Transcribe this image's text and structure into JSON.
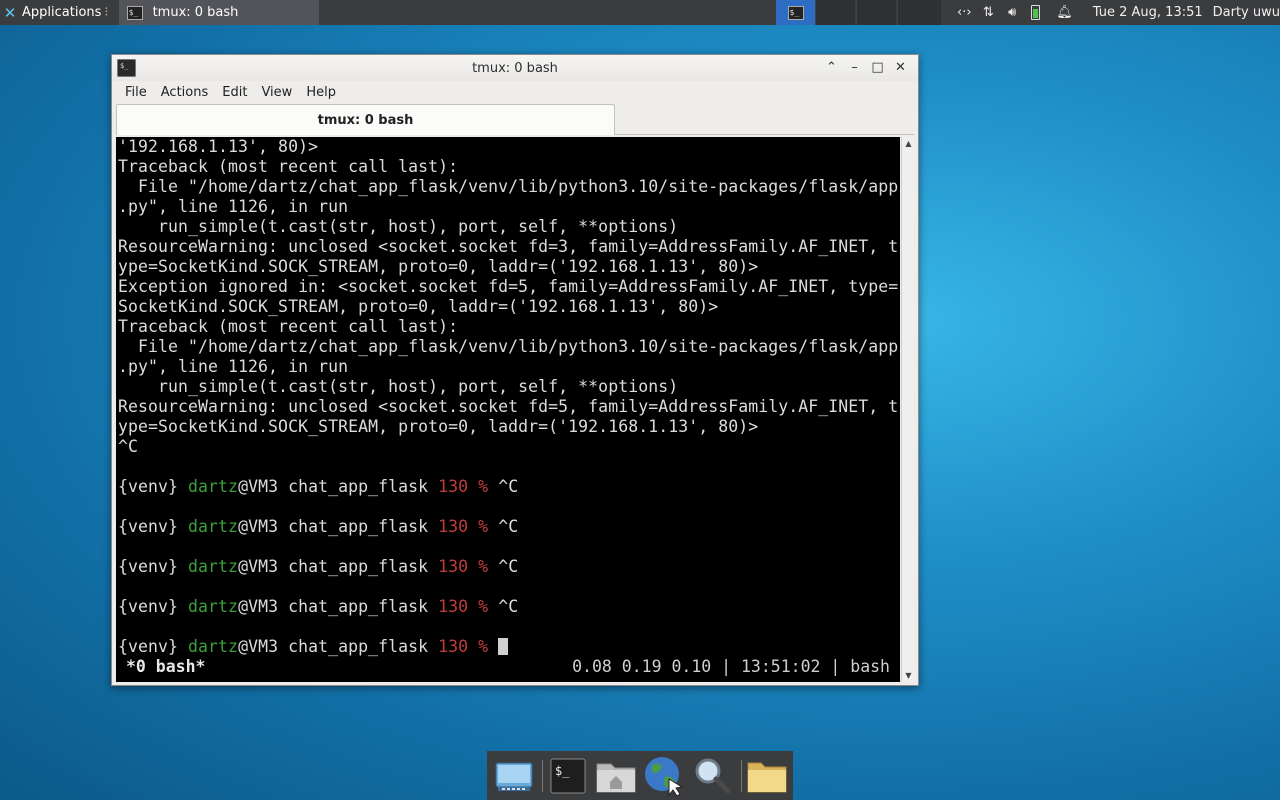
{
  "top_panel": {
    "applications_label": "Applications",
    "task_title": "tmux: 0 bash",
    "clock": "Tue  2 Aug, 13:51",
    "user": "Darty uwu"
  },
  "window": {
    "title": "tmux: 0 bash",
    "menu": [
      "File",
      "Actions",
      "Edit",
      "View",
      "Help"
    ],
    "tab_label": "tmux: 0 bash"
  },
  "terminal": {
    "lines": [
      "'192.168.1.13', 80)>",
      "Traceback (most recent call last):",
      "  File \"/home/dartz/chat_app_flask/venv/lib/python3.10/site-packages/flask/app",
      ".py\", line 1126, in run",
      "    run_simple(t.cast(str, host), port, self, **options)",
      "ResourceWarning: unclosed <socket.socket fd=3, family=AddressFamily.AF_INET, t",
      "ype=SocketKind.SOCK_STREAM, proto=0, laddr=('192.168.1.13', 80)>",
      "Exception ignored in: <socket.socket fd=5, family=AddressFamily.AF_INET, type=",
      "SocketKind.SOCK_STREAM, proto=0, laddr=('192.168.1.13', 80)>",
      "Traceback (most recent call last):",
      "  File \"/home/dartz/chat_app_flask/venv/lib/python3.10/site-packages/flask/app",
      ".py\", line 1126, in run",
      "    run_simple(t.cast(str, host), port, self, **options)",
      "ResourceWarning: unclosed <socket.socket fd=5, family=AddressFamily.AF_INET, t",
      "ype=SocketKind.SOCK_STREAM, proto=0, laddr=('192.168.1.13', 80)>",
      "^C"
    ],
    "prompt": {
      "venv": "{venv}",
      "user": "dartz",
      "host_dir": "@VM3 chat_app_flask",
      "status": "130 %",
      "interrupt": "^C"
    },
    "prompt_repeats": 4,
    "status_bar": {
      "left": "*0 bash*",
      "right": "0.08 0.19 0.10 | 13:51:02 | bash"
    }
  },
  "colors": {
    "green": "#3ca03c",
    "red": "#c03c3c",
    "active_workspace": "#2d6ec4"
  },
  "dock_icons": [
    "screen-icon",
    "terminal-icon",
    "home-folder-icon",
    "web-browser-icon",
    "search-icon",
    "folder-icon"
  ]
}
